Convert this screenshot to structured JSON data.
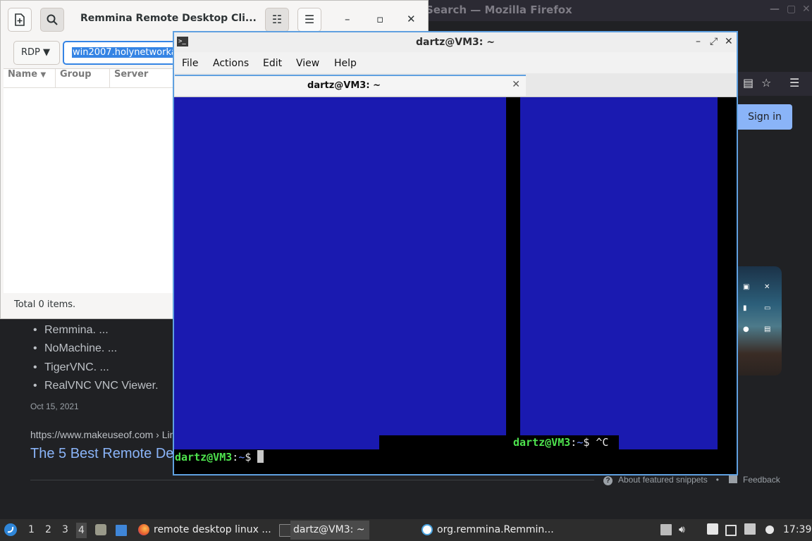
{
  "firefox": {
    "title": "Search — Mozilla Firefox",
    "sign_in": "Sign in",
    "results": {
      "bullets": [
        "Remmina. ...",
        "NoMachine. ...",
        "TigerVNC. ...",
        "RealVNC VNC Viewer."
      ],
      "date": "Oct 15, 2021",
      "url": "https://www.makeuseof.com › Lin",
      "title": "The 5 Best Remote De",
      "about_snippets": "About featured snippets",
      "separator": "•",
      "feedback": "Feedback"
    }
  },
  "remmina": {
    "title": "Remmina Remote Desktop Cli...",
    "protocol": "RDP",
    "server_value": "win2007.holynetworka",
    "columns": [
      "Name",
      "Group",
      "Server"
    ],
    "status": "Total 0 items."
  },
  "terminal": {
    "title": "dartz@VM3: ~",
    "tab_label": "dartz@VM3: ~",
    "menu": [
      "File",
      "Actions",
      "Edit",
      "View",
      "Help"
    ],
    "prompt_user": "dartz@VM3",
    "prompt_sep": ":",
    "prompt_path": "~",
    "prompt_symbol": "$",
    "interrupt": "^C"
  },
  "taskbar": {
    "workspaces": [
      "1",
      "2",
      "3",
      "4"
    ],
    "active_workspace": "4",
    "tasks": [
      "remote desktop linux ...",
      "dartz@VM3: ~",
      "org.remmina.Remmin..."
    ],
    "clock": "17:39"
  },
  "colors": {
    "terminal_blue": "#1a1ab0",
    "prompt_green": "#4ee34e",
    "accent_blue": "#3584e4",
    "link_blue": "#8ab4f8"
  }
}
